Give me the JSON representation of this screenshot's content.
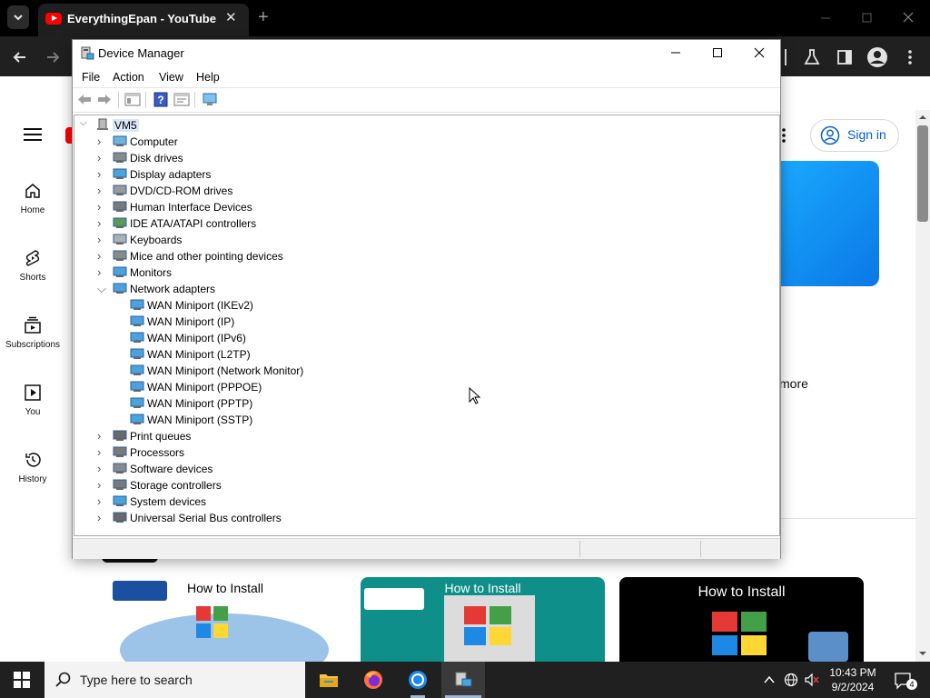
{
  "browser": {
    "tab_title": "EverythingEpan - YouTube",
    "new_tab": "+",
    "tab_close": "✕"
  },
  "youtube": {
    "rail": [
      {
        "label": "Home",
        "icon": "home-icon"
      },
      {
        "label": "Shorts",
        "icon": "shorts-icon"
      },
      {
        "label": "Subscriptions",
        "icon": "subscriptions-icon"
      },
      {
        "label": "You",
        "icon": "you-icon"
      },
      {
        "label": "History",
        "icon": "history-icon"
      }
    ],
    "sign_in": "Sign in",
    "more_text": "more",
    "thumbnails": [
      {
        "caption": "How to Install",
        "bg": "#ffffff"
      },
      {
        "caption": "How to Install",
        "bg": "#0f8f8a"
      },
      {
        "caption": "How to Install",
        "bg": "#000000"
      }
    ]
  },
  "device_manager": {
    "title": "Device Manager",
    "menu": [
      "File",
      "Action",
      "View",
      "Help"
    ],
    "root": "VM5",
    "categories": [
      {
        "label": "Computer",
        "expanded": false
      },
      {
        "label": "Disk drives",
        "expanded": false
      },
      {
        "label": "Display adapters",
        "expanded": false
      },
      {
        "label": "DVD/CD-ROM drives",
        "expanded": false
      },
      {
        "label": "Human Interface Devices",
        "expanded": false
      },
      {
        "label": "IDE ATA/ATAPI controllers",
        "expanded": false
      },
      {
        "label": "Keyboards",
        "expanded": false
      },
      {
        "label": "Mice and other pointing devices",
        "expanded": false
      },
      {
        "label": "Monitors",
        "expanded": false
      },
      {
        "label": "Network adapters",
        "expanded": true
      },
      {
        "label": "Print queues",
        "expanded": false
      },
      {
        "label": "Processors",
        "expanded": false
      },
      {
        "label": "Software devices",
        "expanded": false
      },
      {
        "label": "Storage controllers",
        "expanded": false
      },
      {
        "label": "System devices",
        "expanded": false
      },
      {
        "label": "Universal Serial Bus controllers",
        "expanded": false
      }
    ],
    "network_adapters": [
      "WAN Miniport (IKEv2)",
      "WAN Miniport (IP)",
      "WAN Miniport (IPv6)",
      "WAN Miniport (L2TP)",
      "WAN Miniport (Network Monitor)",
      "WAN Miniport (PPPOE)",
      "WAN Miniport (PPTP)",
      "WAN Miniport (SSTP)"
    ]
  },
  "taskbar": {
    "search_placeholder": "Type here to search",
    "time": "10:43 PM",
    "date": "9/2/2024",
    "notification_count": "4"
  },
  "colors": {
    "accent": "#065fd4",
    "taskbar": "#202020",
    "chrome_frame": "#000000"
  }
}
